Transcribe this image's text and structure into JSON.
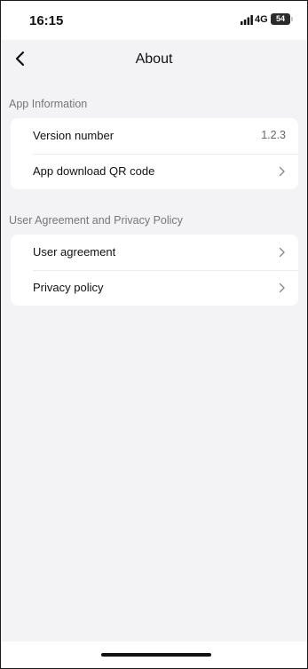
{
  "status_bar": {
    "time": "16:15",
    "network": "4G",
    "battery": "54"
  },
  "header": {
    "title": "About",
    "back_icon": "chevron-left-icon"
  },
  "sections": [
    {
      "label": "App Information",
      "rows": [
        {
          "label": "Version number",
          "value": "1.2.3"
        },
        {
          "label": "App download QR code",
          "icon": "chevron-right-icon"
        }
      ]
    },
    {
      "label": "User Agreement and Privacy Policy",
      "rows": [
        {
          "label": "User agreement",
          "icon": "chevron-right-icon"
        },
        {
          "label": "Privacy policy",
          "icon": "chevron-right-icon"
        }
      ]
    }
  ],
  "colors": {
    "page_background": "#f3f3f6",
    "card_background": "#ffffff",
    "primary_text": "#111111",
    "secondary_text": "#777777"
  }
}
